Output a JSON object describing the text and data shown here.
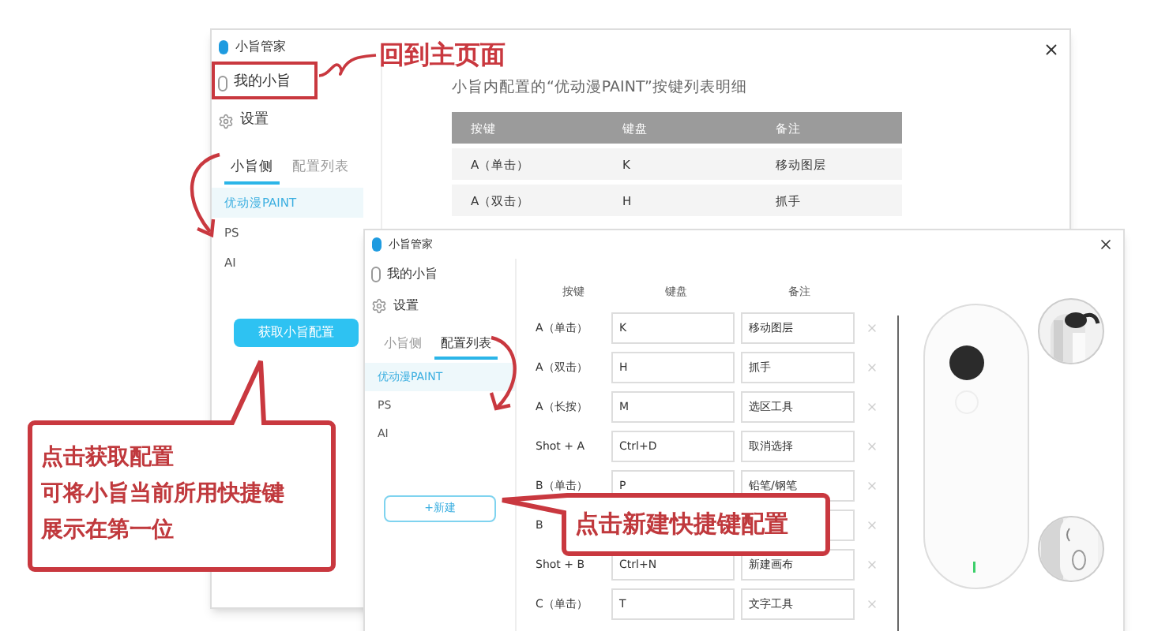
{
  "back_window": {
    "title": "小旨管家",
    "nav": [
      {
        "label": "我的小旨",
        "kind": "device"
      },
      {
        "label": "设置",
        "kind": "settings"
      }
    ],
    "tabs": [
      {
        "label": "小旨侧",
        "selected": true
      },
      {
        "label": "配置列表",
        "selected": false
      }
    ],
    "configs": [
      {
        "label": "优动漫PAINT",
        "selected": true
      },
      {
        "label": "PS",
        "selected": false
      },
      {
        "label": "AI",
        "selected": false
      }
    ],
    "fetch_button": "获取小旨配置",
    "heading": "小旨内配置的“优动漫PAINT”按键列表明细",
    "table": {
      "columns": [
        "按键",
        "键盘",
        "备注"
      ],
      "rows": [
        [
          "A（单击）",
          "K",
          "移动图层"
        ],
        [
          "A（双击）",
          "H",
          "抓手"
        ]
      ]
    }
  },
  "front_window": {
    "title": "小旨管家",
    "nav": [
      {
        "label": "我的小旨",
        "kind": "device"
      },
      {
        "label": "设置",
        "kind": "settings"
      }
    ],
    "tabs": [
      {
        "label": "小旨侧",
        "selected": false
      },
      {
        "label": "配置列表",
        "selected": true
      }
    ],
    "configs": [
      {
        "label": "优动漫PAINT",
        "selected": true
      },
      {
        "label": "PS",
        "selected": false
      },
      {
        "label": "AI",
        "selected": false
      }
    ],
    "new_button": "+新建",
    "columns": [
      "按键",
      "键盘",
      "备注"
    ],
    "rows": [
      {
        "key": "A（单击）",
        "keyboard": "K",
        "note": "移动图层"
      },
      {
        "key": "A（双击）",
        "keyboard": "H",
        "note": "抓手"
      },
      {
        "key": "A（长按）",
        "keyboard": "M",
        "note": "选区工具"
      },
      {
        "key": "Shot + A",
        "keyboard": "Ctrl+D",
        "note": "取消选择"
      },
      {
        "key": "B（单击）",
        "keyboard": "P",
        "note": "铅笔/钢笔"
      },
      {
        "key": "B"
      },
      {
        "key": "Shot + B",
        "keyboard": "Ctrl+N",
        "note": "新建画布"
      },
      {
        "key": "C（单击）",
        "keyboard": "T",
        "note": "文字工具"
      }
    ]
  },
  "annotations": {
    "home": "回到主页面",
    "fetch_callout": [
      "点击获取配置",
      "可将小旨当前所用快捷键",
      "展示在第一位"
    ],
    "new_callout": "点击新建快捷键配置"
  }
}
